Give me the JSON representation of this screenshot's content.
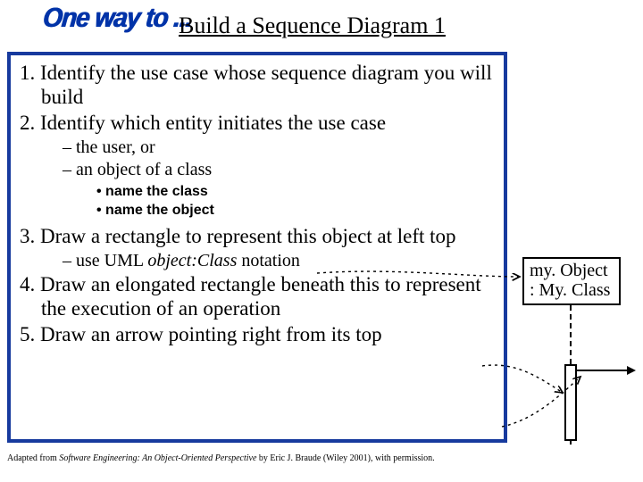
{
  "header": {
    "tag": "One way to ...",
    "title": "Build a Sequence Diagram 1"
  },
  "steps": {
    "s1": "1. Identify the use case whose sequence diagram you will build",
    "s2": "2. Identify which entity initiates the use case",
    "s2_sub": {
      "a": "the user, or",
      "b": "an object of a class"
    },
    "s2_bullets": {
      "a": "name the class",
      "b": "name the object"
    },
    "s3": "3. Draw a rectangle to represent this object at left top",
    "s3_sub": {
      "a_pre": "use UML ",
      "a_ital": "object:Class",
      "a_post": " notation"
    },
    "s4": "4. Draw an elongated rectangle beneath this to represent the execution of an operation",
    "s5": "5. Draw an arrow pointing right from its top"
  },
  "uml": {
    "object_line1": "my. Object",
    "object_line2": ": My. Class"
  },
  "citation": {
    "pre": "Adapted from ",
    "ital": "Software Engineering: An Object-Oriented Perspective",
    "post": " by Eric J. Braude (Wiley 2001), with permission."
  }
}
